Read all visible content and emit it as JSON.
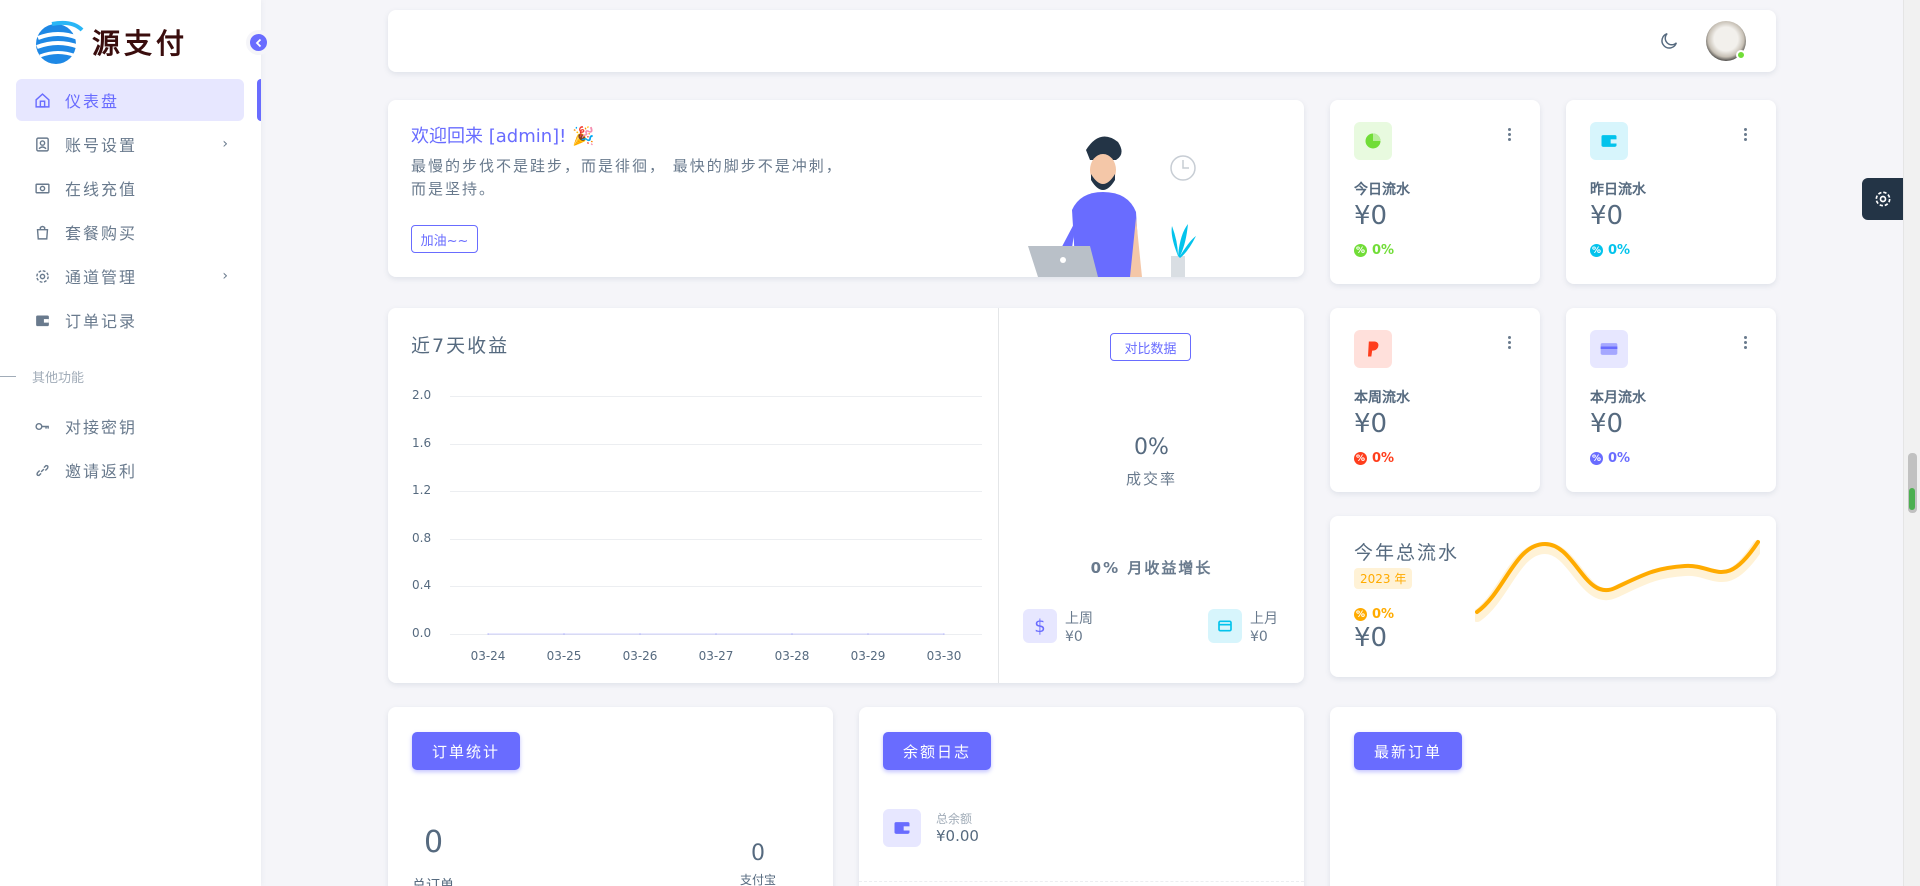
{
  "brand": {
    "name": "源支付"
  },
  "sidebar": {
    "items": [
      {
        "label": "仪表盘",
        "icon": "home-icon",
        "active": true
      },
      {
        "label": "账号设置",
        "icon": "user-card-icon",
        "has_arrow": true
      },
      {
        "label": "在线充值",
        "icon": "cash-icon"
      },
      {
        "label": "套餐购买",
        "icon": "shopping-bag-icon"
      },
      {
        "label": "通道管理",
        "icon": "gear-icon",
        "has_arrow": true
      },
      {
        "label": "订单记录",
        "icon": "wallet-icon"
      }
    ],
    "section_header": "其他功能",
    "extra_items": [
      {
        "label": "对接密钥",
        "icon": "key-icon"
      },
      {
        "label": "邀请返利",
        "icon": "link-icon"
      }
    ]
  },
  "welcome": {
    "title": "欢迎回来 [admin]! 🎉",
    "line1": "最慢的步伐不是跬步，而是徘徊， 最快的脚步不是冲刺，",
    "line2": "而是坚持。",
    "button": "加油~~"
  },
  "stats": [
    {
      "label": "今日流水",
      "value": "¥0",
      "pct": "0%",
      "color": "#71dd37",
      "bg": "#e8fadf",
      "icon": "pie-chart-icon"
    },
    {
      "label": "昨日流水",
      "value": "¥0",
      "pct": "0%",
      "color": "#03c3ec",
      "bg": "#d7f5fc",
      "icon": "wallet-icon"
    },
    {
      "label": "本周流水",
      "value": "¥0",
      "pct": "0%",
      "color": "#ff3e1d",
      "bg": "#ffe0db",
      "icon": "paypal-icon"
    },
    {
      "label": "本月流水",
      "value": "¥0",
      "pct": "0%",
      "color": "#696cff",
      "bg": "#e7e7ff",
      "icon": "credit-card-icon"
    }
  ],
  "revenue": {
    "title": "近7天收益",
    "compare_button": "对比数据",
    "rate_value": "0%",
    "rate_label": "成交率",
    "growth": "0% 月收益增长",
    "last_week_label": "上周",
    "last_week_value": "¥0",
    "last_month_label": "上月",
    "last_month_value": "¥0"
  },
  "chart_data": {
    "type": "line",
    "categories": [
      "03-24",
      "03-25",
      "03-26",
      "03-27",
      "03-28",
      "03-29",
      "03-30"
    ],
    "yticks": [
      "2.0",
      "1.6",
      "1.2",
      "0.8",
      "0.4",
      "0.0"
    ],
    "values": [
      0,
      0,
      0,
      0,
      0,
      0,
      0
    ],
    "ylim": [
      0,
      2.0
    ],
    "grid": true
  },
  "year": {
    "title": "今年总流水",
    "badge": "2023 年",
    "pct": "0%",
    "value": "¥0"
  },
  "bottom": {
    "orders_button": "订单统计",
    "orders_total": "0",
    "orders_total_label": "总订单",
    "orders_alipay": "0",
    "orders_alipay_label": "支付宝",
    "balance_button": "余额日志",
    "balance_label": "总余额",
    "balance_value": "¥0.00",
    "latest_button": "最新订单"
  },
  "colors": {
    "primary": "#696cff",
    "warning": "#ffab00"
  }
}
